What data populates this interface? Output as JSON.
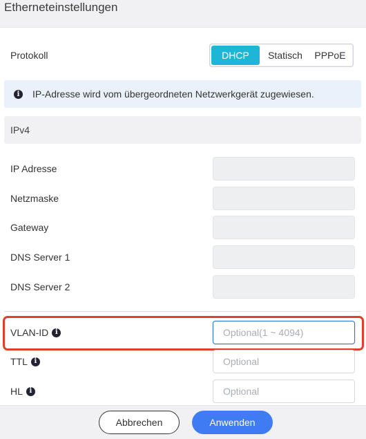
{
  "dialog": {
    "title": "Etherneteinstellungen"
  },
  "protocol": {
    "label": "Protokoll",
    "options": [
      "DHCP",
      "Statisch",
      "PPPoE"
    ],
    "selected": "DHCP"
  },
  "info": {
    "message": "IP-Adresse wird vom übergeordneten Netzwerkgerät zugewiesen."
  },
  "ipv4": {
    "section_title": "IPv4",
    "fields": [
      {
        "label": "IP Adresse",
        "value": ""
      },
      {
        "label": "Netzmaske",
        "value": ""
      },
      {
        "label": "Gateway",
        "value": ""
      },
      {
        "label": "DNS Server 1",
        "value": ""
      },
      {
        "label": "DNS Server 2",
        "value": ""
      }
    ]
  },
  "advanced": {
    "vlan": {
      "label": "VLAN-ID",
      "placeholder": "Optional(1 ~ 4094)",
      "value": ""
    },
    "ttl": {
      "label": "TTL",
      "placeholder": "Optional",
      "value": ""
    },
    "hl": {
      "label": "HL",
      "placeholder": "Optional",
      "value": ""
    }
  },
  "footer": {
    "cancel_label": "Abbrechen",
    "apply_label": "Anwenden"
  },
  "colors": {
    "accent": "#1fb5d6",
    "primary_button": "#3f7bf3",
    "highlight_border": "#e0402b",
    "focus_border": "#2a74e0"
  },
  "icons": {
    "info": "info-circle-icon"
  }
}
